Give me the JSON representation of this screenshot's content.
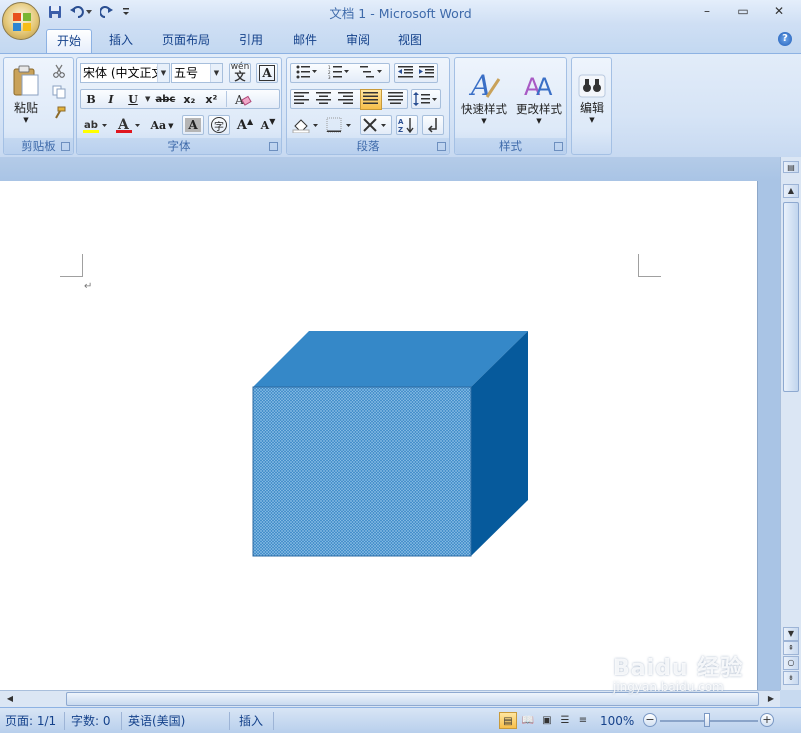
{
  "window": {
    "title": "文档 1 - Microsoft Word",
    "minimize": "–",
    "maximize": "▭",
    "close": "✕"
  },
  "tabs": [
    {
      "label": "开始",
      "active": true
    },
    {
      "label": "插入",
      "active": false
    },
    {
      "label": "页面布局",
      "active": false
    },
    {
      "label": "引用",
      "active": false
    },
    {
      "label": "邮件",
      "active": false
    },
    {
      "label": "审阅",
      "active": false
    },
    {
      "label": "视图",
      "active": false
    }
  ],
  "help": "?",
  "ribbon": {
    "clipboard": {
      "paste_label": "粘贴",
      "group_label": "剪贴板"
    },
    "font": {
      "font_name": "宋体 (中文正文)",
      "font_size": "五号",
      "bold": "B",
      "italic": "I",
      "underline": "U",
      "strike": "abc",
      "subscript": "x₂",
      "superscript": "x²",
      "clear": "Aa",
      "grow": "A",
      "shrink": "A",
      "group_label": "字体"
    },
    "paragraph": {
      "group_label": "段落"
    },
    "styles": {
      "quick_styles_label": "快速样式",
      "change_styles_label": "更改样式",
      "group_label": "样式"
    },
    "editing": {
      "label": "编辑"
    }
  },
  "document": {
    "paragraph_mark": "↵",
    "shape": {
      "type": "cube",
      "front_pattern": "crosshatch",
      "color_front": "#3a88c6",
      "color_top": "#3588c8",
      "color_side": "#065a9c"
    }
  },
  "statusbar": {
    "page": "页面: 1/1",
    "words": "字数: 0",
    "language": "英语(美国)",
    "mode": "插入",
    "zoom": "100%"
  },
  "watermark": {
    "text": "Baidu 经验",
    "sub": "jingyan.baidu.com"
  }
}
